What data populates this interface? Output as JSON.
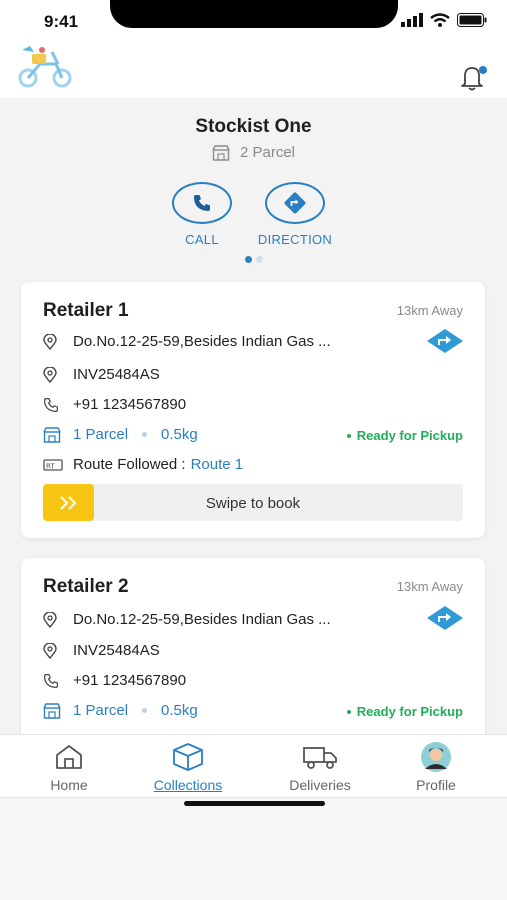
{
  "status_bar": {
    "time": "9:41"
  },
  "stockist": {
    "name": "Stockist One",
    "parcel_count": "2 Parcel",
    "call_label": "CALL",
    "direction_label": "DIRECTION"
  },
  "retailers": [
    {
      "name": "Retailer 1",
      "distance": "13km Away",
      "address": "Do.No.12-25-59,Besides Indian Gas ...",
      "invoice": "INV25484AS",
      "phone": "+91 1234567890",
      "parcel": "1 Parcel",
      "weight": "0.5kg",
      "status": "Ready for Pickup",
      "route_label": "Route Followed :",
      "route_value": "Route 1",
      "swipe_label": "Swipe to book"
    },
    {
      "name": "Retailer 2",
      "distance": "13km Away",
      "address": "Do.No.12-25-59,Besides Indian Gas ...",
      "invoice": "INV25484AS",
      "phone": "+91 1234567890",
      "parcel": "1 Parcel",
      "weight": "0.5kg",
      "status": "Ready for Pickup"
    }
  ],
  "tabs": [
    {
      "label": "Home",
      "icon": "home-icon"
    },
    {
      "label": "Collections",
      "icon": "box-icon",
      "active": true
    },
    {
      "label": "Deliveries",
      "icon": "truck-icon"
    },
    {
      "label": "Profile",
      "icon": "avatar"
    }
  ],
  "colors": {
    "accent": "#2a7fc1",
    "success": "#1fae5a",
    "swipe_knob": "#f7c613"
  }
}
